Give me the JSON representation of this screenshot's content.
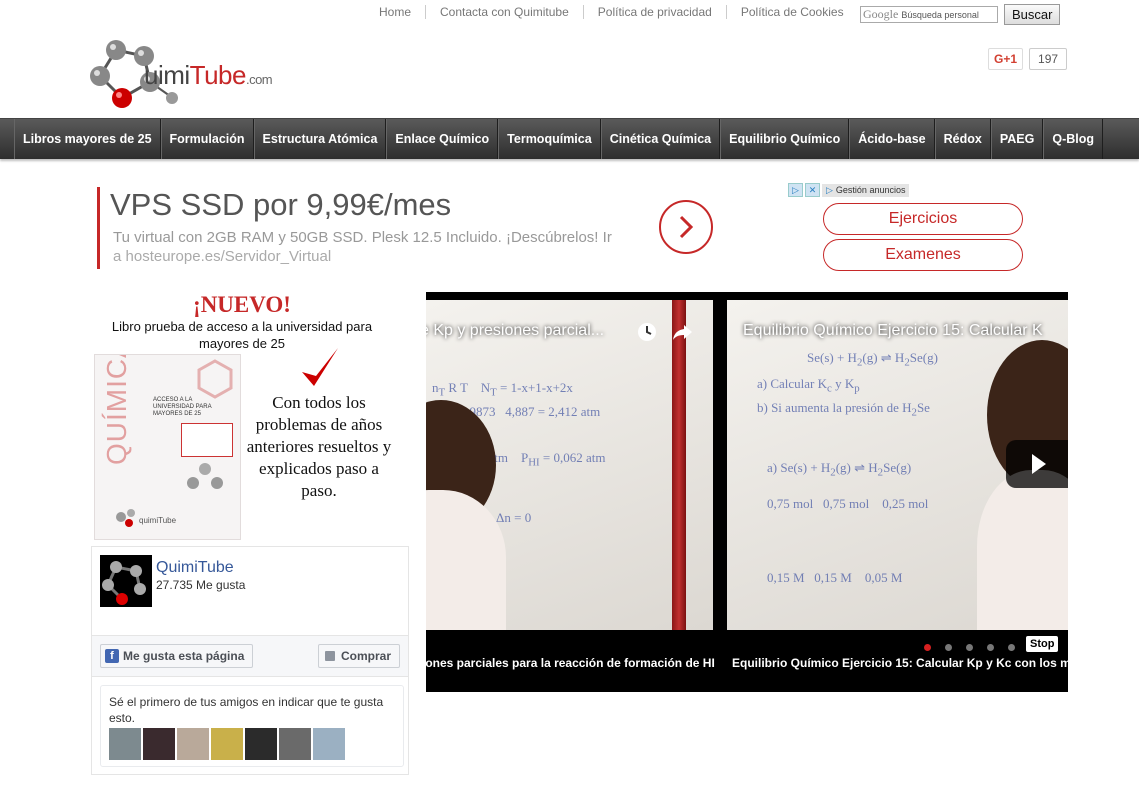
{
  "top_links": [
    "Home",
    "Contacta con Quimitube",
    "Política de privacidad",
    "Política de Cookies"
  ],
  "search": {
    "google_label": "Google",
    "placeholder": "Búsqueda personal",
    "button": "Buscar"
  },
  "logo": {
    "part1": "uimi",
    "part2": "Tube",
    "suffix": ".com"
  },
  "gplus": {
    "label": "G+1",
    "count": "197"
  },
  "nav": [
    "Libros mayores de 25",
    "Formulación",
    "Estructura Atómica",
    "Enlace Químico",
    "Termoquímica",
    "Cinética Química",
    "Equilibrio Químico",
    "Ácido-base",
    "Rédox",
    "PAEG",
    "Q-Blog"
  ],
  "ad": {
    "headline": "VPS SSD por 9,99€/mes",
    "desc": "Tu virtual con 2GB RAM y 50GB SSD. Plesk 12.5 Incluido. ¡Descúbrelos! Ir",
    "url": "a hosteurope.es/Servidor_Virtual",
    "adchoices": "Gestión anuncios"
  },
  "side_buttons": [
    "Ejercicios",
    "Examenes"
  ],
  "promo": {
    "nuevo": "¡NUEVO!",
    "subtitle": "Libro prueba de acceso a la universidad para mayores de 25",
    "book_word": "QUÍMICA",
    "book_line": "ACCESO A LA UNIVERSIDAD PARA MAYORES DE 25",
    "text": "Con todos los problemas de años anteriores resueltos y explicados paso a paso."
  },
  "fb": {
    "page_name": "QuimiTube",
    "likes": "27.735 Me gusta",
    "like_button": "Me gusta esta página",
    "buy_button": "Comprar",
    "friends_text": "Sé el primero de tus amigos en indicar que te gusta esto.",
    "face_colors": [
      "#7d8a8f",
      "#3a2a2e",
      "#b9a99a",
      "#c9b04a",
      "#2b2b2b",
      "#6a6a6a",
      "#9bb0c2"
    ]
  },
  "video": {
    "title1": "e Kp y presiones parcial...",
    "title2": "Equilibrio Químico Ejercicio 15: Calcular K",
    "caption1": "iones parciales para la reacción de formación de HI",
    "caption2": "Equilibrio Químico Ejercicio 15: Calcular Kp y Kc con los m",
    "stop": "Stop",
    "dots": 5,
    "active_dot": 0
  },
  "colors": {
    "brand_red": "#c62828",
    "nav_bg": "#3a3a3a",
    "fb_blue": "#4267b2"
  }
}
